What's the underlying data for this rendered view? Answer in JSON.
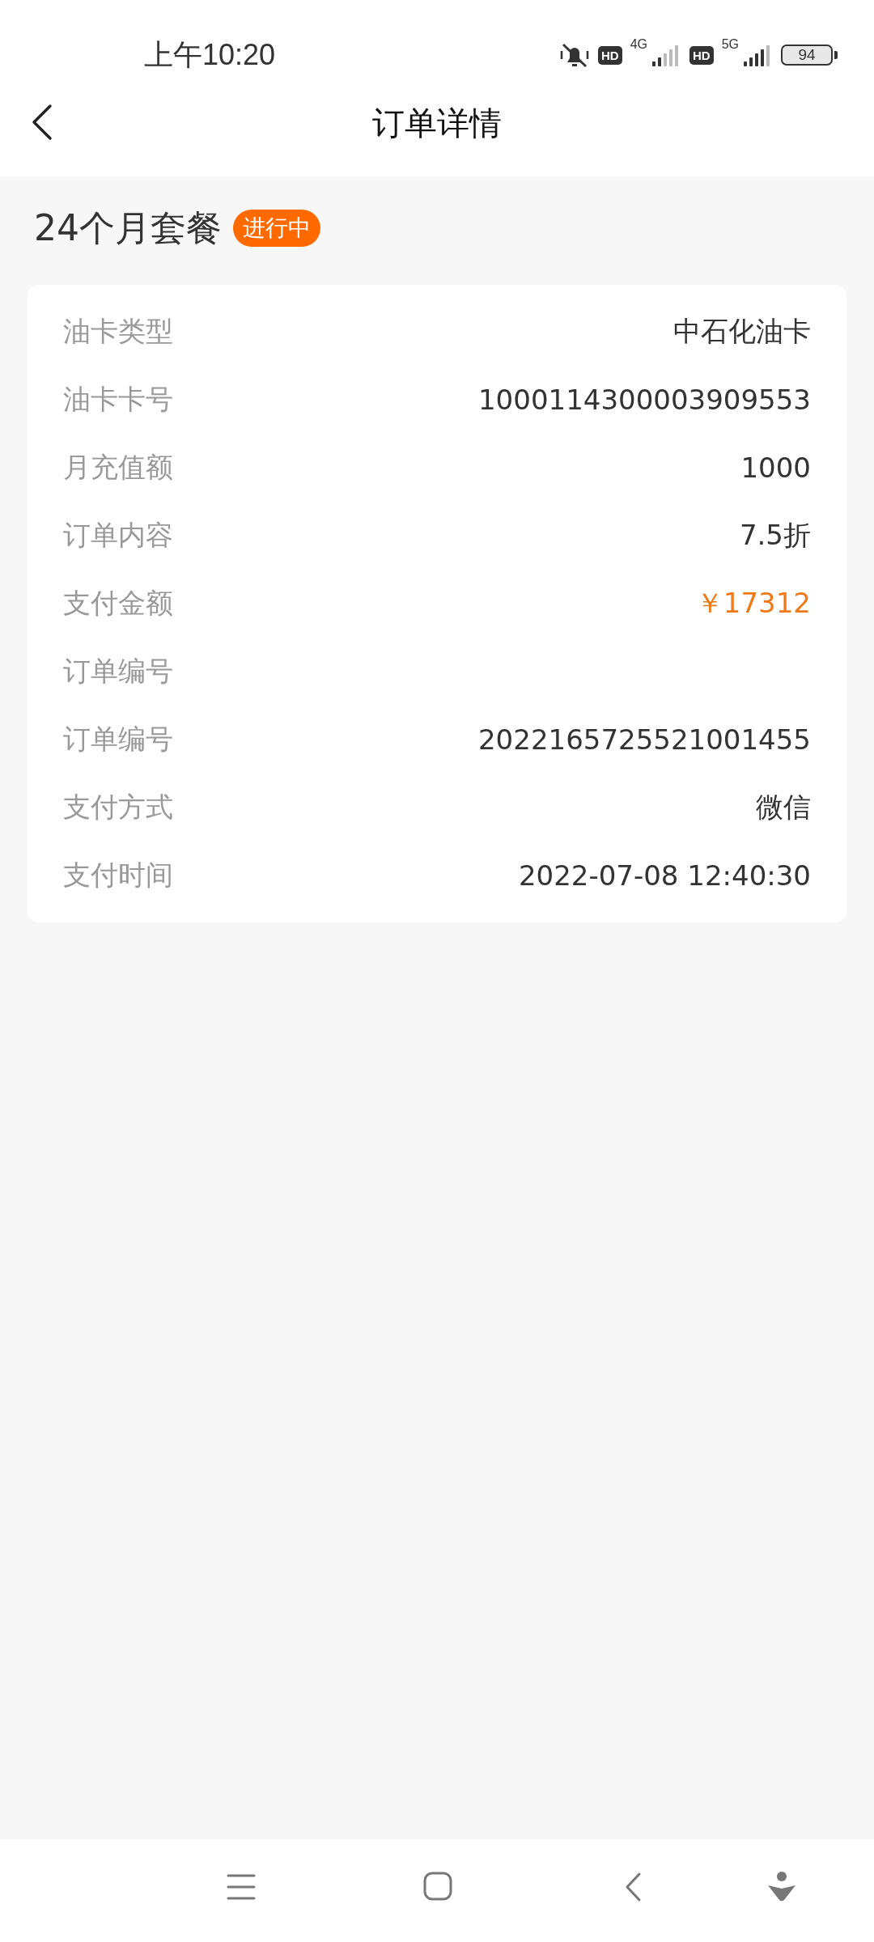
{
  "status_bar": {
    "time": "上午10:20",
    "sim1": {
      "hd": "HD",
      "network": "4G"
    },
    "sim2": {
      "hd": "HD",
      "network": "5G"
    },
    "battery": "94"
  },
  "header": {
    "title": "订单详情"
  },
  "order": {
    "name": "24个月套餐",
    "status": "进行中",
    "rows": [
      {
        "label": "油卡类型",
        "value": "中石化油卡",
        "kind": "plain"
      },
      {
        "label": "油卡卡号",
        "value": "1000114300003909553",
        "kind": "plain"
      },
      {
        "label": "月充值额",
        "value": "1000",
        "kind": "plain"
      },
      {
        "label": "订单内容",
        "value": "7.5折",
        "kind": "plain"
      },
      {
        "label": "支付金额",
        "value": "￥17312",
        "kind": "amount"
      },
      {
        "label": "订单编号",
        "kind": "plain"
      },
      {
        "label": "订单编号",
        "value": "2022165725521001455",
        "kind": "plain"
      },
      {
        "label": "支付方式",
        "value": "微信",
        "kind": "plain"
      },
      {
        "label": "支付时间",
        "value": "2022-07-08 12:40:30",
        "kind": "plain"
      }
    ]
  }
}
